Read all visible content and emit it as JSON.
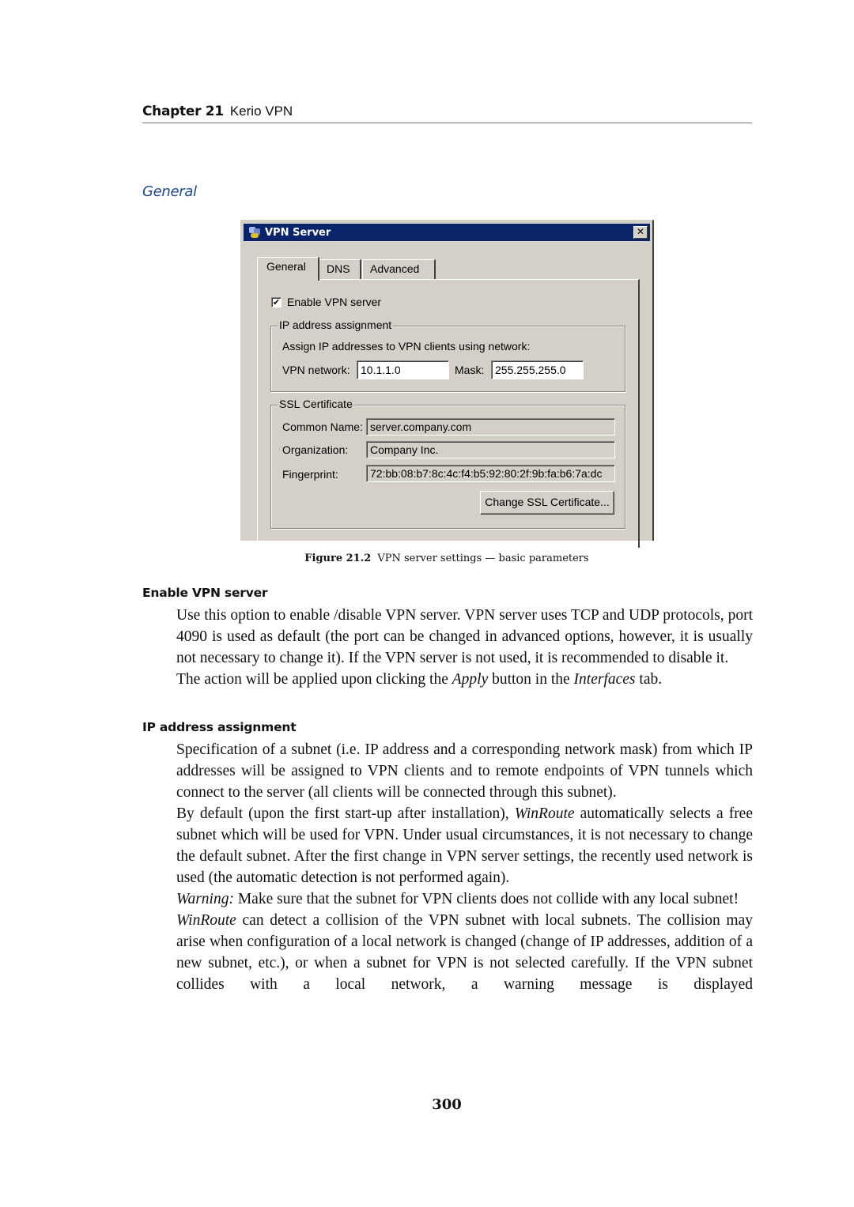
{
  "running_head": {
    "chapter": "Chapter 21",
    "title": "Kerio VPN"
  },
  "section_title": "General",
  "dialog": {
    "title": "VPN Server",
    "title_icon": "vpn-server-app-icon",
    "close_glyph": "✕",
    "tabs": [
      {
        "label": "General",
        "active": true
      },
      {
        "label": "DNS",
        "active": false
      },
      {
        "label": "Advanced",
        "active": false
      }
    ],
    "enable_checkbox": {
      "label": "Enable VPN server",
      "checked": true,
      "glyph": "✔"
    },
    "ip_group": {
      "legend": "IP address assignment",
      "description": "Assign IP addresses to VPN clients using network:",
      "network_label": "VPN network:",
      "network_value": "10.1.1.0",
      "mask_label": "Mask:",
      "mask_value": "255.255.255.0"
    },
    "ssl_group": {
      "legend": "SSL Certificate",
      "common_name_label": "Common Name:",
      "common_name_value": "server.company.com",
      "organization_label": "Organization:",
      "organization_value": "Company Inc.",
      "fingerprint_label": "Fingerprint:",
      "fingerprint_value": "72:bb:08:b7:8c:4c:f4:b5:92:80:2f:9b:fa:b6:7a:dc",
      "change_button": "Change SSL Certificate..."
    }
  },
  "caption": {
    "number": "Figure 21.2",
    "text": "VPN server settings — basic parameters"
  },
  "definitions": [
    {
      "term": "Enable VPN server",
      "paragraphs": [
        {
          "text": "Use this option to enable /disable VPN server. VPN server uses TCP and UDP protocols, port 4090 is used as default (the port can be changed in advanced options, however, it is usually not necessary to change it). If the VPN server is not used, it is recommended to disable it."
        },
        {
          "pre": "The action will be applied upon clicking the ",
          "em1": "Apply",
          "mid": " button in the ",
          "em2": "Interfaces",
          "post": " tab."
        }
      ]
    },
    {
      "term": "IP address assignment",
      "paragraphs": [
        {
          "text": "Specification of a subnet (i.e. IP address and a corresponding network mask) from which IP addresses will be assigned to VPN clients and to remote endpoints of VPN tunnels which connect to the server (all clients will be connected through this subnet)."
        },
        {
          "pre": "By default (upon the first start-up after installation), ",
          "em1": "WinRoute",
          "post": " automatically selects a free subnet which will be used for VPN. Under usual circumstances, it is not necessary to change the default subnet. After the first change in VPN server settings, the recently used network is used (the automatic detection is not performed again)."
        },
        {
          "em1": "Warning:",
          "post": " Make sure that the subnet for VPN clients does not collide with any local subnet!"
        },
        {
          "em1": "WinRoute",
          "post": " can detect a collision of the VPN subnet with local subnets. The collision may arise when configuration of a local network is changed (change of IP addresses, addition of a new subnet, etc.), or when a subnet for VPN is not selected carefully. If the VPN subnet collides with a local network, a warning message is displayed"
        }
      ]
    }
  ],
  "page_number": "300",
  "colors": {
    "section_title": "#1e4a8c",
    "titlebar": "#0a246a",
    "dialog_bg": "#d4d0c8"
  }
}
